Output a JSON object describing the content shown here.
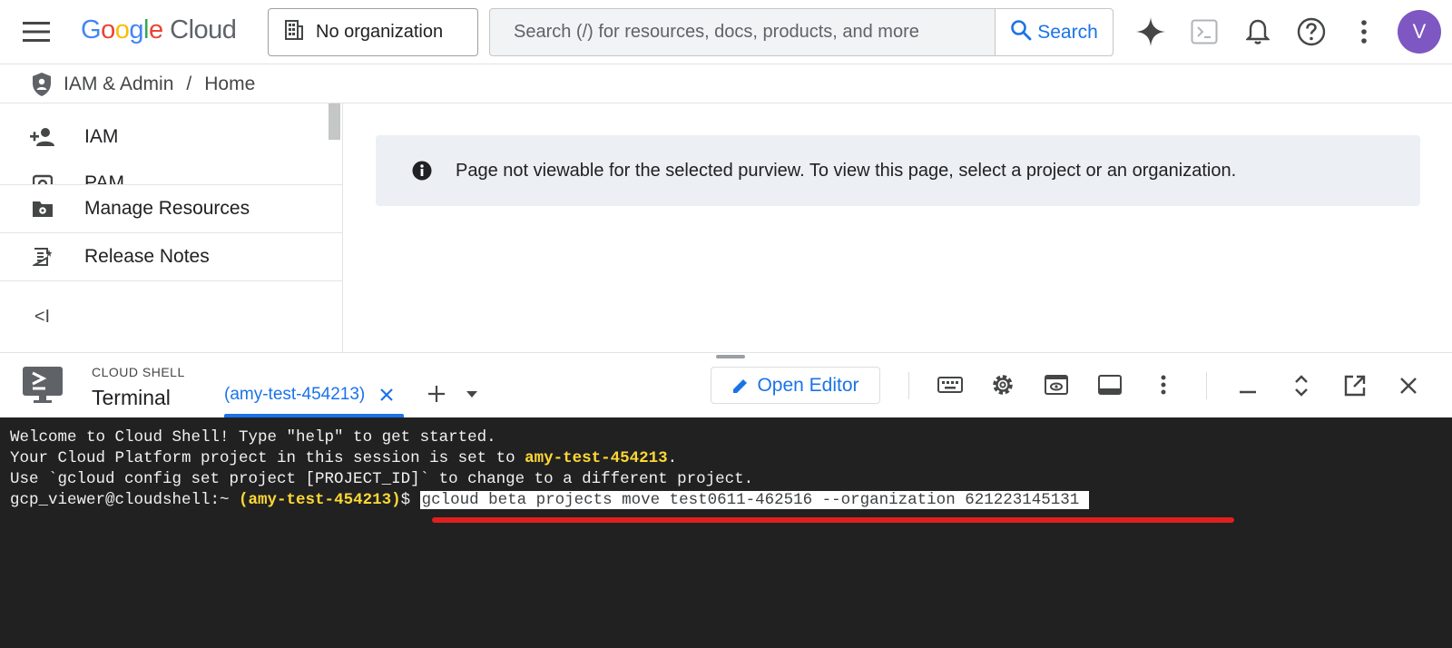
{
  "header": {
    "logo_letters": [
      "G",
      "o",
      "o",
      "g",
      "l",
      "e"
    ],
    "logo_product": "Cloud",
    "org_selector_label": "No organization",
    "search_placeholder": "Search (/) for resources, docs, products, and more",
    "search_button_label": "Search",
    "avatar_initial": "V"
  },
  "breadcrumb": {
    "section": "IAM & Admin",
    "separator": "/",
    "page": "Home"
  },
  "sidebar": {
    "items": [
      {
        "label": "IAM",
        "icon": "person-add-icon"
      },
      {
        "label": "PAM",
        "icon": "camera-shield-icon"
      },
      {
        "label": "Manage Resources",
        "icon": "folder-gear-icon"
      },
      {
        "label": "Release Notes",
        "icon": "notes-icon"
      }
    ],
    "collapse_label": "<I"
  },
  "main": {
    "banner_text": "Page not viewable for the selected purview. To view this page, select a project or an organization."
  },
  "cloud_shell": {
    "section_label": "CLOUD SHELL",
    "title": "Terminal",
    "tab_label": "(amy-test-454213)",
    "open_editor_label": "Open Editor",
    "terminal": {
      "line1": "Welcome to Cloud Shell! Type \"help\" to get started.",
      "line2_prefix": "Your Cloud Platform project in this session is set to ",
      "line2_project": "amy-test-454213",
      "line2_suffix": ".",
      "line3": "Use `gcloud config set project [PROJECT_ID]` to change to a different project.",
      "prompt_user": "gcp_viewer@cloudshell:~ ",
      "prompt_project": "(amy-test-454213)",
      "prompt_symbol": "$ ",
      "command": "gcloud beta projects move test0611-462516 --organization 621223145131"
    }
  },
  "colors": {
    "accent": "#1a73e8",
    "avatar": "#7e57c2",
    "terminal_bg": "#212121",
    "terminal_highlight": "#fdd835",
    "annotation_underline": "#e02020"
  }
}
